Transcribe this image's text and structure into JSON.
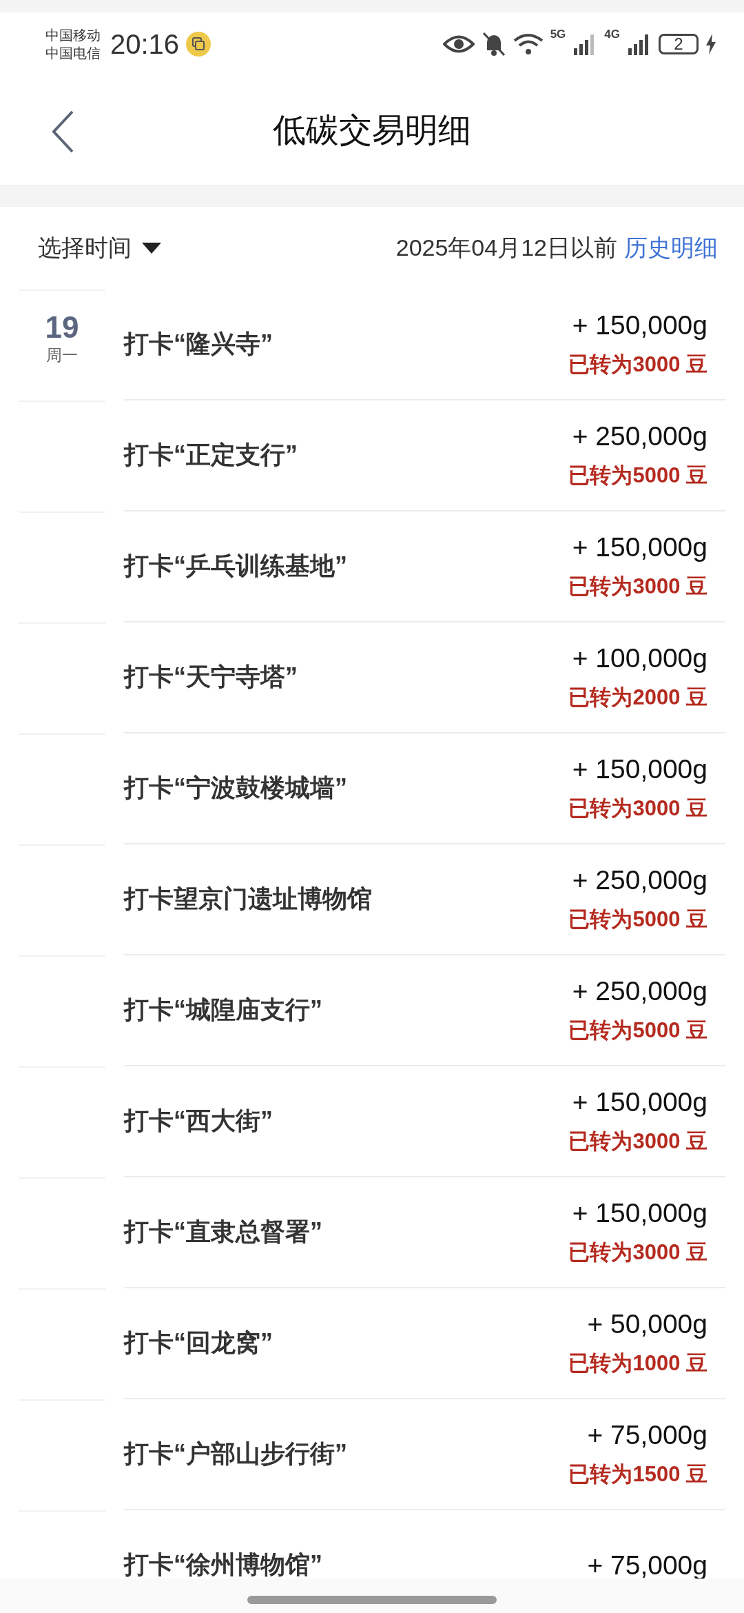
{
  "status_bar": {
    "carriers": [
      "中国移动",
      "中国电信"
    ],
    "time": "20:16",
    "network_5g": "5G",
    "network_4g": "4G",
    "battery": "2"
  },
  "header": {
    "title": "低碳交易明细"
  },
  "filter": {
    "label": "选择时间",
    "cutoff": "2025年04月12日以前",
    "history_link": "历史明细"
  },
  "rows": [
    {
      "day": "19",
      "weekday": "周一",
      "title": "打卡“隆兴寺”",
      "amount": "+ 150,000g",
      "converted": "已转为3000 豆"
    },
    {
      "title": "打卡“正定支行”",
      "amount": "+ 250,000g",
      "converted": "已转为5000 豆"
    },
    {
      "title": "打卡“乒乓训练基地”",
      "amount": "+ 150,000g",
      "converted": "已转为3000 豆"
    },
    {
      "title": "打卡“天宁寺塔”",
      "amount": "+ 100,000g",
      "converted": "已转为2000 豆"
    },
    {
      "title": "打卡“宁波鼓楼城墙”",
      "amount": "+ 150,000g",
      "converted": "已转为3000 豆"
    },
    {
      "title": "打卡望京门遗址博物馆",
      "amount": "+ 250,000g",
      "converted": "已转为5000 豆"
    },
    {
      "title": "打卡“城隍庙支行”",
      "amount": "+ 250,000g",
      "converted": "已转为5000 豆"
    },
    {
      "title": "打卡“西大街”",
      "amount": "+ 150,000g",
      "converted": "已转为3000 豆"
    },
    {
      "title": "打卡“直隶总督署”",
      "amount": "+ 150,000g",
      "converted": "已转为3000 豆"
    },
    {
      "title": "打卡“回龙窝”",
      "amount": "+ 50,000g",
      "converted": "已转为1000 豆"
    },
    {
      "title": "打卡“户部山步行街”",
      "amount": "+ 75,000g",
      "converted": "已转为1500 豆"
    },
    {
      "title": "打卡“徐州博物馆”",
      "amount": "+ 75,000g"
    }
  ]
}
